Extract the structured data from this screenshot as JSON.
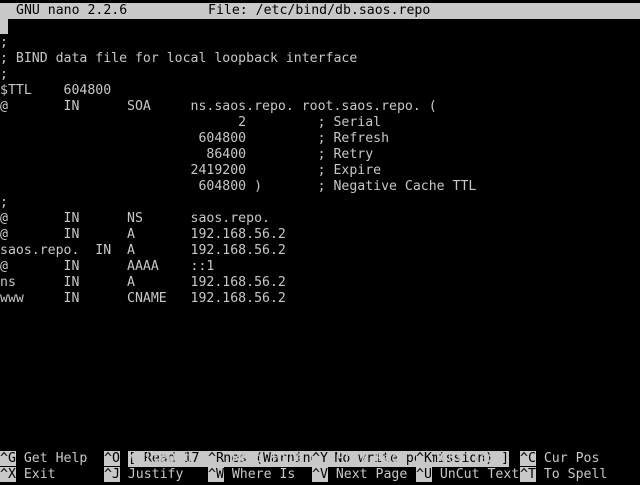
{
  "title_bar": {
    "app": "GNU nano 2.2.6",
    "file": "File: /etc/bind/db.saos.repo"
  },
  "content": {
    "lines": [
      "",
      ";",
      "; BIND data file for local loopback interface",
      ";",
      "$TTL    604800",
      "@       IN      SOA     ns.saos.repo. root.saos.repo. (",
      "                              2         ; Serial",
      "                         604800         ; Refresh",
      "                          86400         ; Retry",
      "                        2419200         ; Expire",
      "                         604800 )       ; Negative Cache TTL",
      ";",
      "@       IN      NS      saos.repo.",
      "@       IN      A       192.168.56.2",
      "saos.repo.  IN  A       192.168.56.2",
      "@       IN      AAAA    ::1",
      "ns      IN      A       192.168.56.2",
      "www     IN      CNAME   192.168.56.2"
    ]
  },
  "status": "[ Read 17 lines (Warning: No write permission) ]",
  "shortcuts": {
    "row1": [
      {
        "key": "^G",
        "label": "Get Help"
      },
      {
        "key": "^O",
        "label": "WriteOut"
      },
      {
        "key": "^R",
        "label": "Read File"
      },
      {
        "key": "^Y",
        "label": "Prev Page"
      },
      {
        "key": "^K",
        "label": "Cut Text"
      },
      {
        "key": "^C",
        "label": "Cur Pos"
      }
    ],
    "row2": [
      {
        "key": "^X",
        "label": "Exit"
      },
      {
        "key": "^J",
        "label": "Justify"
      },
      {
        "key": "^W",
        "label": "Where Is"
      },
      {
        "key": "^V",
        "label": "Next Page"
      },
      {
        "key": "^U",
        "label": "UnCut Text"
      },
      {
        "key": "^T",
        "label": "To Spell"
      }
    ]
  }
}
